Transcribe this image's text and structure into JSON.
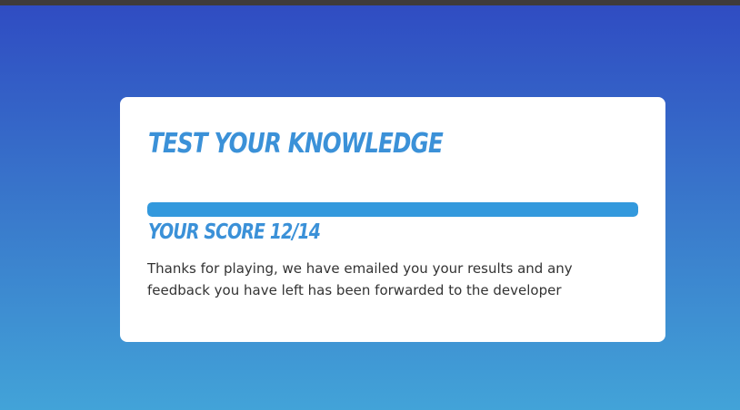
{
  "quiz": {
    "title": "Test Your Knowledge",
    "progress_fraction": 1.0,
    "score_text": "Your Score 12/14",
    "message": "Thanks for playing, we have emailed you your results and any feedback you have left has been forwarded to the developer"
  },
  "colors": {
    "accent": "#3b91d8",
    "progress": "#3399dd",
    "background_top": "#2f4bc2",
    "background_bottom": "#42a3d8",
    "card": "#ffffff",
    "text": "#333333"
  }
}
